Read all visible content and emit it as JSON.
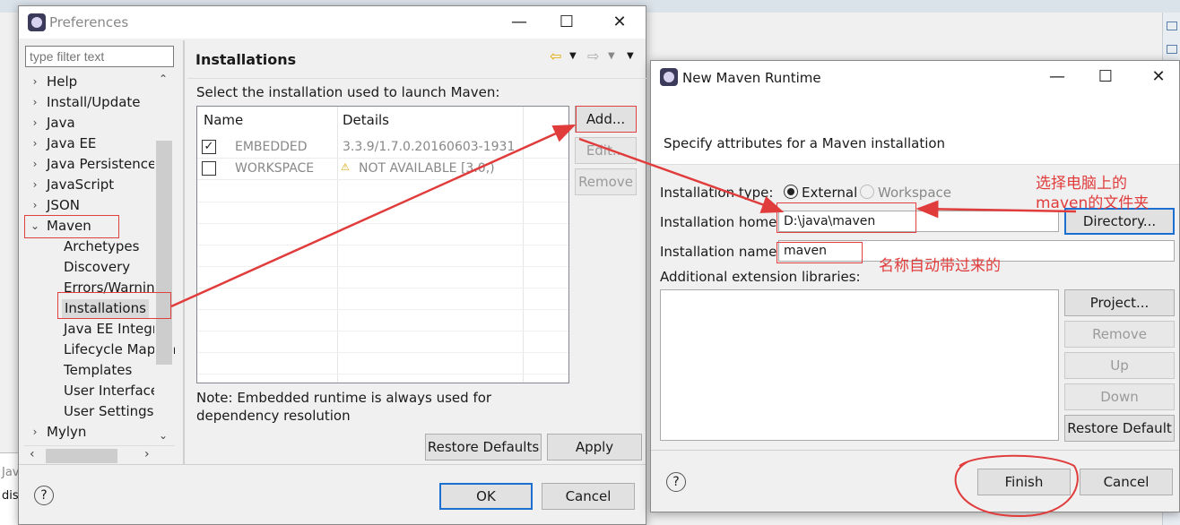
{
  "prefs": {
    "title": "Preferences",
    "filter_placeholder": "type filter text",
    "tree": {
      "help": "Help",
      "install_update": "Install/Update",
      "java": "Java",
      "java_ee": "Java EE",
      "java_persistence": "Java Persistence",
      "javascript": "JavaScript",
      "json": "JSON",
      "maven": "Maven",
      "archetypes": "Archetypes",
      "discovery": "Discovery",
      "errors_warnings": "Errors/Warnings",
      "installations": "Installations",
      "java_ee_integration": "Java EE Integration",
      "lifecycle_mappings": "Lifecycle Mappings",
      "templates": "Templates",
      "user_interface": "User Interface",
      "user_settings": "User Settings",
      "mylyn": "Mylyn"
    },
    "page_title": "Installations",
    "select_label": "Select the installation used to launch Maven:",
    "columns": {
      "name": "Name",
      "details": "Details"
    },
    "rows": [
      {
        "name": "EMBEDDED",
        "details": "3.3.9/1.7.0.20160603-1931",
        "checked": "✓"
      },
      {
        "name": "WORKSPACE",
        "details": "NOT AVAILABLE [3.0,)",
        "checked": ""
      }
    ],
    "add": "Add...",
    "edit": "Edit...",
    "remove": "Remove",
    "note": "Note: Embedded runtime is always used for dependency resolution",
    "restore_defaults": "Restore Defaults",
    "apply": "Apply",
    "ok": "OK",
    "cancel": "Cancel"
  },
  "maven": {
    "title": "New Maven Runtime",
    "header": "Specify attributes for a Maven installation",
    "type_label": "Installation type:",
    "external": "External",
    "workspace": "Workspace",
    "home_label": "Installation home:",
    "home_value": "D:\\java\\maven",
    "directory": "Directory...",
    "name_label": "Installation name:",
    "name_value": "maven",
    "ext_label": "Additional extension libraries:",
    "project": "Project...",
    "remove": "Remove",
    "up": "Up",
    "down": "Down",
    "restore_default": "Restore Default",
    "finish": "Finish",
    "cancel": "Cancel"
  },
  "annotations": {
    "select_folder": "选择电脑上的maven的文件夹",
    "auto_name": "名称自动带过来的"
  },
  "background": {
    "side_text_1": "Jav",
    "side_text_2": "dis"
  },
  "colors": {
    "annotation_red": "#e03c3c",
    "accent_blue": "#1b6fd1"
  }
}
